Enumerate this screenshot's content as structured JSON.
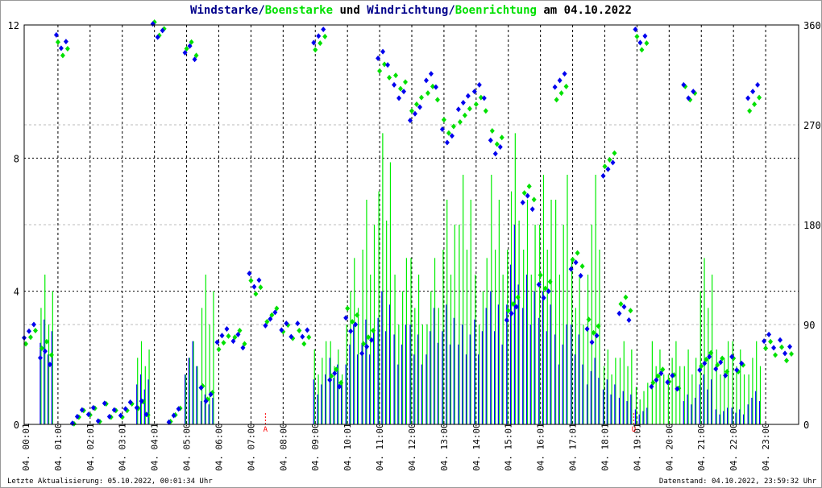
{
  "title": {
    "part1": "Windstarke/",
    "part2": "Boenstarke",
    "part3": " und ",
    "part4": "Windrichtung/",
    "part5": "Boenrichtung",
    "part6": " am 04.10.2022"
  },
  "colors": {
    "wind": "#0000ff",
    "gust": "#00ee00",
    "dir": "#0000ee",
    "gustdir": "#00e000",
    "marker": "#ff0000"
  },
  "footer": {
    "left": "Letzte Aktualisierung: 05.10.2022, 00:01:34 Uhr",
    "right": "Datenstand: 04.10.2022, 23:59:32 Uhr"
  },
  "chart_data": {
    "type": "bar",
    "title": "Windstarke/Boenstarke und Windrichtung/Boenrichtung am 04.10.2022",
    "ylim": [
      0,
      12
    ],
    "y2lim": [
      0,
      360
    ],
    "yticks": [
      "0",
      "4",
      "8",
      "12"
    ],
    "y2ticks": [
      "0",
      "90",
      "180",
      "270",
      "360"
    ],
    "xticks": [
      "04. 00:01",
      "04. 01:00",
      "04. 02:01",
      "04. 03:01",
      "04. 04:01",
      "04. 05:00",
      "04. 06:00",
      "04. 07:00",
      "04. 08:00",
      "04. 09:00",
      "04. 10:01",
      "04. 11:00",
      "04. 12:00",
      "04. 13:00",
      "04. 14:00",
      "04. 15:01",
      "04. 16:01",
      "04. 17:01",
      "04. 18:01",
      "04. 19:01",
      "04. 20:00",
      "04. 21:00",
      "04. 22:00",
      "04. 23:00"
    ],
    "markers": [
      {
        "label": "A",
        "hour": 7.5
      },
      {
        "label": "U",
        "hour": 18.95
      }
    ],
    "hours": [
      0,
      0.5,
      1,
      1.5,
      2,
      2.5,
      3,
      3.5,
      4,
      4.5,
      5,
      5.5,
      6,
      6.5,
      7,
      7.5,
      8,
      8.5,
      9,
      9.5,
      10,
      10.5,
      11,
      11.5,
      12,
      12.5,
      13,
      13.5,
      14,
      14.5,
      15,
      15.5,
      16,
      16.5,
      17,
      17.5,
      18,
      18.5,
      19,
      19.5,
      20,
      20.5,
      21,
      21.5,
      22,
      22.5,
      23,
      23.5
    ],
    "series": [
      {
        "name": "Windstarke",
        "axis": "left",
        "values": [
          0,
          3.5,
          0,
          0,
          0,
          0,
          0,
          1.5,
          0,
          0,
          2.5,
          1,
          0,
          0,
          0,
          0,
          0,
          0,
          1.5,
          2,
          3,
          3.5,
          4,
          3,
          3,
          3.5,
          4,
          3,
          3.5,
          4,
          6,
          5,
          4,
          3,
          3,
          2,
          1.5,
          1,
          0.5,
          0,
          0,
          1,
          1.5,
          0.5,
          0.5,
          1,
          0,
          0
        ]
      },
      {
        "name": "Boenstarke",
        "axis": "left",
        "values": [
          0,
          5,
          0,
          0,
          0,
          0,
          0,
          2.5,
          0,
          0,
          2.5,
          5,
          0,
          0,
          0,
          0,
          0,
          0,
          2.5,
          2.5,
          5,
          7.5,
          8.75,
          5,
          5,
          5,
          7.5,
          7.5,
          5,
          7.5,
          8.75,
          7.5,
          7.5,
          7.5,
          5,
          7.5,
          2.5,
          2.5,
          1.25,
          2.5,
          2.5,
          2.5,
          5,
          2.5,
          2.5,
          2.5,
          0,
          0
        ]
      },
      {
        "name": "Windrichtung",
        "axis": "right",
        "values": [
          84,
          60,
          345,
          7,
          9,
          13,
          14,
          15,
          355,
          8,
          335,
          27,
          80,
          75,
          130,
          95,
          85,
          85,
          350,
          40,
          90,
          70,
          330,
          300,
          280,
          310,
          260,
          290,
          300,
          250,
          100,
          200,
          120,
          310,
          140,
          80,
          230,
          100,
          350,
          40,
          38,
          300,
          55,
          50,
          55,
          300,
          75,
          70
        ]
      },
      {
        "name": "Boenrichtung",
        "axis": "right",
        "values": [
          80,
          70,
          340,
          8,
          10,
          14,
          14,
          16,
          358,
          10,
          340,
          30,
          75,
          80,
          125,
          100,
          85,
          80,
          345,
          45,
          100,
          80,
          320,
          310,
          290,
          300,
          270,
          280,
          290,
          260,
          110,
          210,
          130,
          300,
          150,
          90,
          240,
          110,
          345,
          45,
          40,
          300,
          60,
          55,
          55,
          290,
          70,
          65
        ]
      }
    ]
  }
}
